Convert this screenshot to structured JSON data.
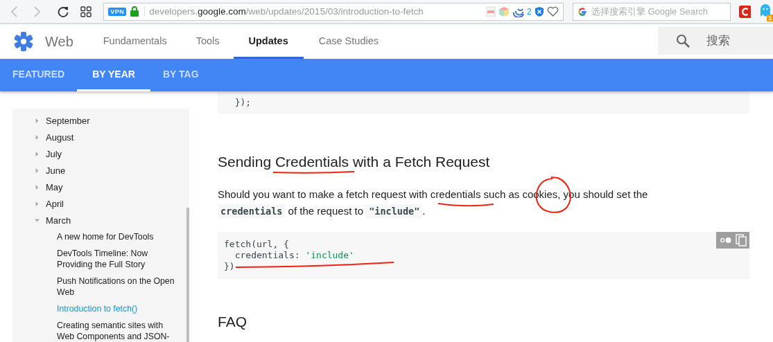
{
  "browser": {
    "nav_buttons": [
      {
        "kind": "back",
        "disabled": true
      },
      {
        "kind": "forward",
        "disabled": true
      }
    ],
    "address": {
      "badge": "VPN",
      "url_prefix": "developers.",
      "url_domain": "google.com",
      "url_rest": "/web/updates/2015/03/introduction-to-fetch",
      "extension_count": "2"
    },
    "search": {
      "placeholder": "选择搜索引擎 Google Search"
    },
    "notification_count": "1"
  },
  "site_header": {
    "title": "Web",
    "nav": [
      {
        "label": "Fundamentals",
        "selected": false
      },
      {
        "label": "Tools",
        "selected": false
      },
      {
        "label": "Updates",
        "selected": true
      },
      {
        "label": "Case Studies",
        "selected": false
      }
    ],
    "search": {
      "placeholder": "搜索"
    }
  },
  "sub_tabs": [
    {
      "label": "FEATURED",
      "selected": false
    },
    {
      "label": "BY YEAR",
      "selected": true
    },
    {
      "label": "BY TAG",
      "selected": false
    }
  ],
  "sidebar": {
    "items": [
      {
        "label": "September",
        "expanded": false
      },
      {
        "label": "August",
        "expanded": false
      },
      {
        "label": "July",
        "expanded": false
      },
      {
        "label": "June",
        "expanded": false
      },
      {
        "label": "May",
        "expanded": false
      },
      {
        "label": "April",
        "expanded": false
      },
      {
        "label": "March",
        "expanded": true,
        "children": [
          {
            "label": "A new home for DevTools",
            "selected": false
          },
          {
            "label": "DevTools Timeline: Now Providing the Full Story",
            "selected": false
          },
          {
            "label": "Push Notifications on the Open Web",
            "selected": false
          },
          {
            "label": "Introduction to fetch()",
            "selected": true
          },
          {
            "label": "Creating semantic sites with Web Components and JSON-",
            "selected": false
          }
        ]
      }
    ]
  },
  "article": {
    "top_code": [
      "  });"
    ],
    "heading": "Sending Credentials with a Fetch Request",
    "paragraph": [
      {
        "kind": "text",
        "text": "Should you want to make a fetch request with credentials such as cookies, you should set the "
      },
      {
        "kind": "code",
        "text": "credentials"
      },
      {
        "kind": "text",
        "text": " of the request to "
      },
      {
        "kind": "code",
        "text": "\"include\""
      },
      {
        "kind": "text",
        "text": "."
      }
    ],
    "code": [
      [
        {
          "kind": "plain",
          "text": "fetch(url, {"
        }
      ],
      [
        {
          "kind": "plain",
          "text": "  credentials: "
        },
        {
          "kind": "string",
          "text": "'include'"
        }
      ],
      [
        {
          "kind": "plain",
          "text": "})"
        }
      ]
    ],
    "heading_2": "FAQ"
  }
}
